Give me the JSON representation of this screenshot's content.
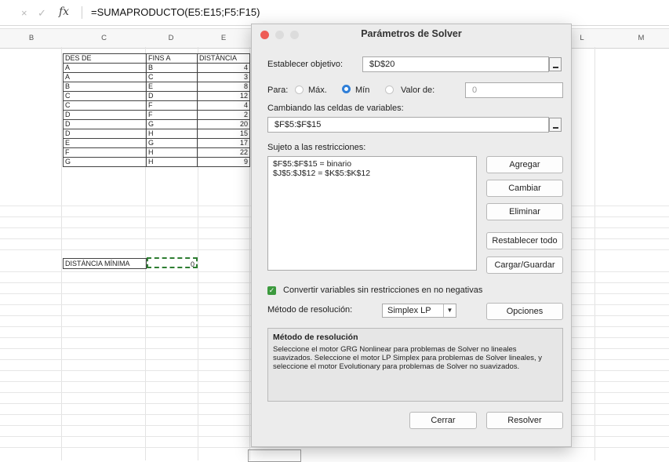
{
  "formula_bar": {
    "cancel_icon": "×",
    "confirm_icon": "✓",
    "fx_label": "fx",
    "formula": "=SUMAPRODUCTO(E5:E15;F5:F15)"
  },
  "columns": [
    "B",
    "C",
    "D",
    "E",
    "L",
    "M"
  ],
  "table": {
    "headers": [
      "DES DE",
      "FINS A",
      "DISTÀNCIA"
    ],
    "rows": [
      [
        "A",
        "B",
        "4"
      ],
      [
        "A",
        "C",
        "3"
      ],
      [
        "B",
        "E",
        "8"
      ],
      [
        "C",
        "D",
        "12"
      ],
      [
        "C",
        "F",
        "4"
      ],
      [
        "D",
        "F",
        "2"
      ],
      [
        "D",
        "G",
        "20"
      ],
      [
        "D",
        "H",
        "15"
      ],
      [
        "E",
        "G",
        "17"
      ],
      [
        "F",
        "H",
        "22"
      ],
      [
        "G",
        "H",
        "9"
      ]
    ]
  },
  "summary": {
    "label": "DISTÀNCIA MÍNIMA",
    "value": "0"
  },
  "dialog": {
    "title": "Parámetros de Solver",
    "objective_label": "Establecer objetivo:",
    "objective_value": "$D$20",
    "to_label": "Para:",
    "max_label": "Máx.",
    "min_label": "Mín",
    "value_of_label": "Valor de:",
    "value_of_value": "0",
    "variables_label": "Cambiando las celdas de variables:",
    "variables_value": "$F$5:$F$15",
    "constraints_label": "Sujeto a las restricciones:",
    "constraints": [
      "$F$5:$F$15 = binario",
      "$J$5:$J$12 = $K$5:$K$12"
    ],
    "add_button": "Agregar",
    "change_button": "Cambiar",
    "delete_button": "Eliminar",
    "reset_button": "Restablecer todo",
    "load_save_button": "Cargar/Guardar",
    "nonneg_label": "Convertir variables sin restricciones en no negativas",
    "method_label": "Método de resolución:",
    "method_value": "Simplex LP",
    "options_button": "Opciones",
    "info_title": "Método de resolución",
    "info_text": "Seleccione el motor GRG Nonlinear para problemas de Solver no lineales suavizados. Seleccione el motor LP Simplex para problemas de Solver lineales, y seleccione el motor Evolutionary para problemas de Solver no suavizados.",
    "close_button": "Cerrar",
    "solve_button": "Resolver"
  }
}
